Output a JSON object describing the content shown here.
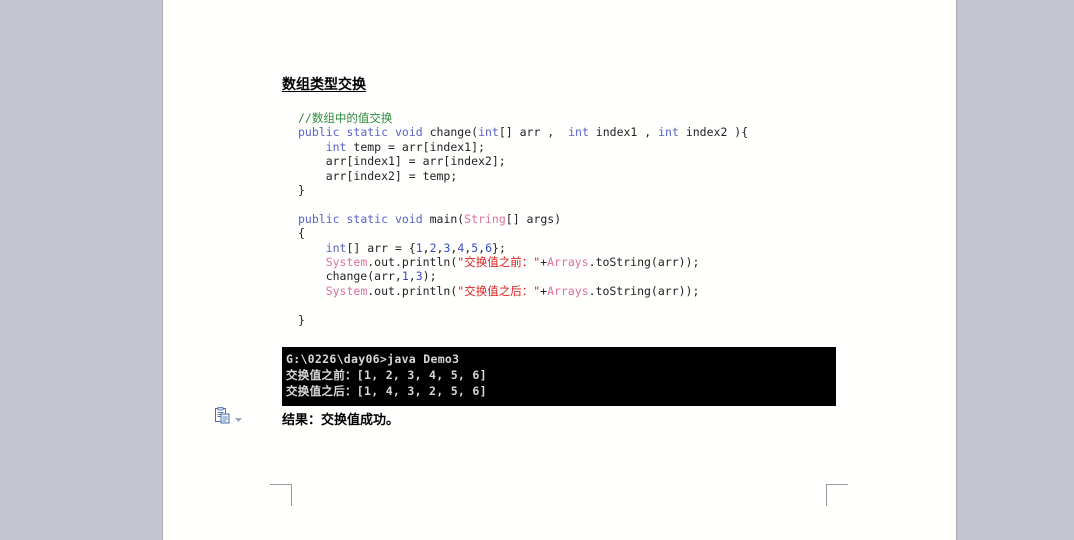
{
  "document": {
    "heading": "数组类型交换",
    "caption": "结果：交换值成功。"
  },
  "code": {
    "language": "java",
    "lines": [
      [
        {
          "t": "//数组中的值交换",
          "c": "cm"
        }
      ],
      [
        {
          "t": "public",
          "c": "kw"
        },
        {
          "t": " ",
          "c": "pl"
        },
        {
          "t": "static",
          "c": "kw"
        },
        {
          "t": " ",
          "c": "pl"
        },
        {
          "t": "void",
          "c": "kw"
        },
        {
          "t": " change(",
          "c": "pl"
        },
        {
          "t": "int",
          "c": "kw"
        },
        {
          "t": "[] arr ,  ",
          "c": "pl"
        },
        {
          "t": "int",
          "c": "kw"
        },
        {
          "t": " index1 , ",
          "c": "pl"
        },
        {
          "t": "int",
          "c": "kw"
        },
        {
          "t": " index2 ){",
          "c": "pl"
        }
      ],
      [
        {
          "t": "    ",
          "c": "pl"
        },
        {
          "t": "int",
          "c": "kw"
        },
        {
          "t": " temp = arr[index1];",
          "c": "pl"
        }
      ],
      [
        {
          "t": "    arr[index1] = arr[index2];",
          "c": "pl"
        }
      ],
      [
        {
          "t": "    arr[index2] = temp;",
          "c": "pl"
        }
      ],
      [
        {
          "t": "}",
          "c": "pl"
        }
      ],
      [
        {
          "t": "",
          "c": "pl"
        }
      ],
      [
        {
          "t": "public",
          "c": "kw"
        },
        {
          "t": " ",
          "c": "pl"
        },
        {
          "t": "static",
          "c": "kw"
        },
        {
          "t": " ",
          "c": "pl"
        },
        {
          "t": "void",
          "c": "kw"
        },
        {
          "t": " main(",
          "c": "pl"
        },
        {
          "t": "String",
          "c": "ty"
        },
        {
          "t": "[] args)",
          "c": "pl"
        }
      ],
      [
        {
          "t": "{",
          "c": "pl"
        }
      ],
      [
        {
          "t": "    ",
          "c": "pl"
        },
        {
          "t": "int",
          "c": "kw"
        },
        {
          "t": "[] arr = {",
          "c": "pl"
        },
        {
          "t": "1",
          "c": "nm"
        },
        {
          "t": ",",
          "c": "pl"
        },
        {
          "t": "2",
          "c": "nm"
        },
        {
          "t": ",",
          "c": "pl"
        },
        {
          "t": "3",
          "c": "nm"
        },
        {
          "t": ",",
          "c": "pl"
        },
        {
          "t": "4",
          "c": "nm"
        },
        {
          "t": ",",
          "c": "pl"
        },
        {
          "t": "5",
          "c": "nm"
        },
        {
          "t": ",",
          "c": "pl"
        },
        {
          "t": "6",
          "c": "nm"
        },
        {
          "t": "};",
          "c": "pl"
        }
      ],
      [
        {
          "t": "    ",
          "c": "pl"
        },
        {
          "t": "System",
          "c": "ty"
        },
        {
          "t": ".out.println(",
          "c": "pl"
        },
        {
          "t": "\"交换值之前：\"",
          "c": "st"
        },
        {
          "t": "+",
          "c": "pl"
        },
        {
          "t": "Arrays",
          "c": "ty"
        },
        {
          "t": ".toString(arr));",
          "c": "pl"
        }
      ],
      [
        {
          "t": "    change(arr,",
          "c": "pl"
        },
        {
          "t": "1",
          "c": "nm"
        },
        {
          "t": ",",
          "c": "pl"
        },
        {
          "t": "3",
          "c": "nm"
        },
        {
          "t": ");",
          "c": "pl"
        }
      ],
      [
        {
          "t": "    ",
          "c": "pl"
        },
        {
          "t": "System",
          "c": "ty"
        },
        {
          "t": ".out.println(",
          "c": "pl"
        },
        {
          "t": "\"交换值之后：\"",
          "c": "st"
        },
        {
          "t": "+",
          "c": "pl"
        },
        {
          "t": "Arrays",
          "c": "ty"
        },
        {
          "t": ".toString(arr));",
          "c": "pl"
        }
      ],
      [
        {
          "t": "",
          "c": "pl"
        }
      ],
      [
        {
          "t": "}",
          "c": "pl"
        }
      ]
    ]
  },
  "console": {
    "lines": [
      "G:\\0226\\day06>java Demo3",
      "交换值之前：[1, 2, 3, 4, 5, 6]",
      "交换值之后：[1, 4, 3, 2, 5, 6]"
    ]
  },
  "paste_options": {
    "icon": "paste-options-icon",
    "caret": "chevron-down-icon"
  },
  "colors": {
    "workspace": "#c3c6ce",
    "page": "#fffffd",
    "comment": "#2e8b3c",
    "keyword": "#5a62c8",
    "type": "#e0709a",
    "string": "#dd1e1e",
    "number": "#3b49c9",
    "console_bg": "#000000",
    "console_fg": "#d8d8d8"
  }
}
